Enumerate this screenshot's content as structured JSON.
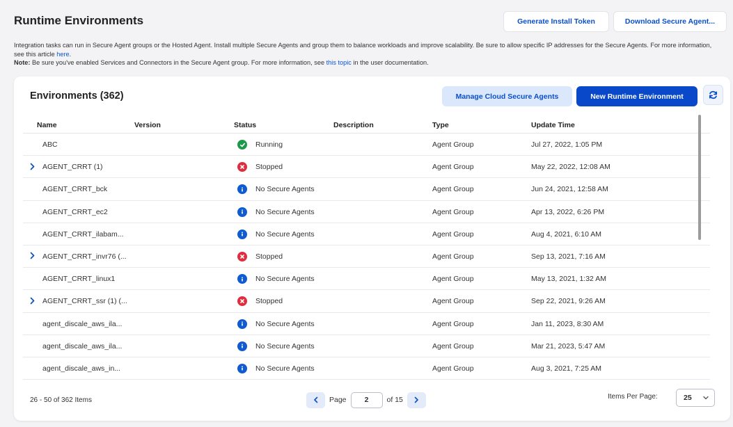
{
  "header": {
    "title": "Runtime Environments",
    "generate_token_label": "Generate Install Token",
    "download_agent_label": "Download Secure Agent..."
  },
  "intro": {
    "line1": "Integration tasks can run in Secure Agent groups or the Hosted Agent. Install multiple Secure Agents and group them to balance workloads and improve scalability. Be sure to allow specific IP addresses for the Secure Agents. For more information, see this article ",
    "here_link": "here",
    "line1_end": ".",
    "note_label": "Note:",
    "note_text": " Be sure you've enabled Services and Connectors in the Secure Agent group. For more information, see ",
    "topic_link": "this topic",
    "note_end": " in the user documentation."
  },
  "card": {
    "title": "Environments (362)",
    "manage_label": "Manage Cloud Secure Agents",
    "new_label": "New Runtime Environment"
  },
  "table": {
    "columns": [
      "Name",
      "Version",
      "Status",
      "Description",
      "Type",
      "Update Time"
    ],
    "rows": [
      {
        "name": "ABC",
        "status": "Running",
        "status_type": "running",
        "type": "Agent Group",
        "updated": "Jul 27, 2022, 1:05 PM",
        "expandable": false
      },
      {
        "name": "AGENT_CRRT (1)",
        "status": "Stopped",
        "status_type": "stopped",
        "type": "Agent Group",
        "updated": "May 22, 2022, 12:08 AM",
        "expandable": true
      },
      {
        "name": "AGENT_CRRT_bck",
        "status": "No Secure Agents",
        "status_type": "info",
        "type": "Agent Group",
        "updated": "Jun 24, 2021, 12:58 AM",
        "expandable": false
      },
      {
        "name": "AGENT_CRRT_ec2",
        "status": "No Secure Agents",
        "status_type": "info",
        "type": "Agent Group",
        "updated": "Apr 13, 2022, 6:26 PM",
        "expandable": false
      },
      {
        "name": "AGENT_CRRT_ilabam...",
        "status": "No Secure Agents",
        "status_type": "info",
        "type": "Agent Group",
        "updated": "Aug 4, 2021, 6:10 AM",
        "expandable": false
      },
      {
        "name": "AGENT_CRRT_invr76 (...",
        "status": "Stopped",
        "status_type": "stopped",
        "type": "Agent Group",
        "updated": "Sep 13, 2021, 7:16 AM",
        "expandable": true
      },
      {
        "name": "AGENT_CRRT_linux1",
        "status": "No Secure Agents",
        "status_type": "info",
        "type": "Agent Group",
        "updated": "May 13, 2021, 1:32 AM",
        "expandable": false
      },
      {
        "name": "AGENT_CRRT_ssr (1) (...",
        "status": "Stopped",
        "status_type": "stopped",
        "type": "Agent Group",
        "updated": "Sep 22, 2021, 9:26 AM",
        "expandable": true
      },
      {
        "name": "agent_discale_aws_ila...",
        "status": "No Secure Agents",
        "status_type": "info",
        "type": "Agent Group",
        "updated": "Jan 11, 2023, 8:30 AM",
        "expandable": false
      },
      {
        "name": "agent_discale_aws_ila...",
        "status": "No Secure Agents",
        "status_type": "info",
        "type": "Agent Group",
        "updated": "Mar 21, 2023, 5:47 AM",
        "expandable": false
      },
      {
        "name": "agent_discale_aws_in...",
        "status": "No Secure Agents",
        "status_type": "info",
        "type": "Agent Group",
        "updated": "Aug 3, 2021, 7:25 AM",
        "expandable": false
      }
    ]
  },
  "footer": {
    "count_text": "26 - 50 of 362 Items",
    "page_label": "Page",
    "page_value": "2",
    "of_label": "of 15",
    "items_per_page_label": "Items Per Page:",
    "items_per_page_value": "25"
  },
  "colors": {
    "primary": "#0948c8",
    "running": "#1c9a4a",
    "stopped": "#df2f3f",
    "info": "#0f5bd2"
  }
}
